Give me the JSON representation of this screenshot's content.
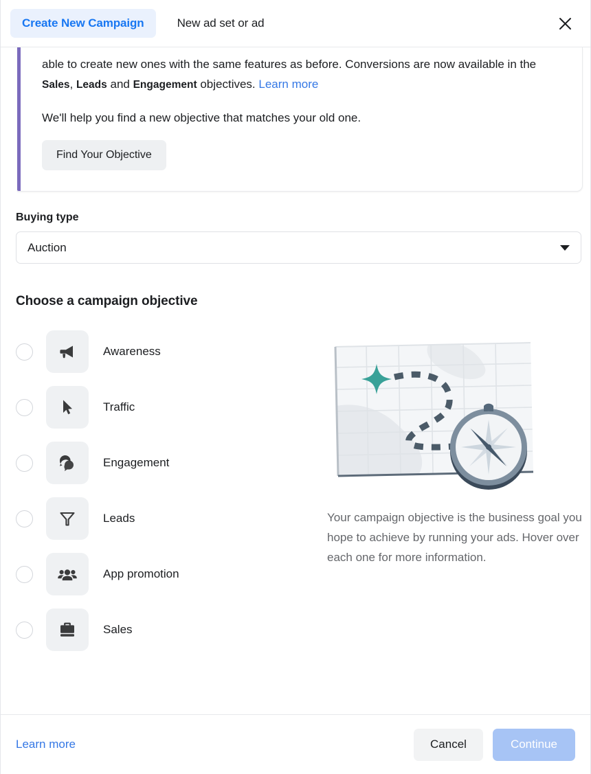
{
  "header": {
    "tab_active": "Create New Campaign",
    "tab_inactive": "New ad set or ad",
    "close_icon": "close-icon"
  },
  "notice": {
    "line1_part1": "able to create new ones with the same features as before. Conversions are now available in the ",
    "bold1": "Sales",
    "sep1": ", ",
    "bold2": "Leads",
    "sep2": " and ",
    "bold3": "Engagement",
    "line1_part2": " objectives. ",
    "link": "Learn more",
    "line2": "We'll help you find a new objective that matches your old one.",
    "button": "Find Your Objective",
    "accent_color": "#7b6bbd"
  },
  "buying_type": {
    "label": "Buying type",
    "value": "Auction",
    "caret_icon": "chevron-down-icon"
  },
  "objectives": {
    "title": "Choose a campaign objective",
    "items": [
      {
        "label": "Awareness",
        "icon": "megaphone-icon",
        "selected": false
      },
      {
        "label": "Traffic",
        "icon": "cursor-icon",
        "selected": false
      },
      {
        "label": "Engagement",
        "icon": "chat-bubble-icon",
        "selected": false
      },
      {
        "label": "Leads",
        "icon": "funnel-icon",
        "selected": false
      },
      {
        "label": "App promotion",
        "icon": "people-icon",
        "selected": false
      },
      {
        "label": "Sales",
        "icon": "briefcase-icon",
        "selected": false
      }
    ]
  },
  "info": {
    "illustration": "map-and-compass-illustration",
    "description": "Your campaign objective is the business goal you hope to achieve by running your ads. Hover over each one for more information."
  },
  "footer": {
    "learn_more": "Learn more",
    "cancel": "Cancel",
    "continue": "Continue",
    "continue_color": "#a3c1f5"
  }
}
